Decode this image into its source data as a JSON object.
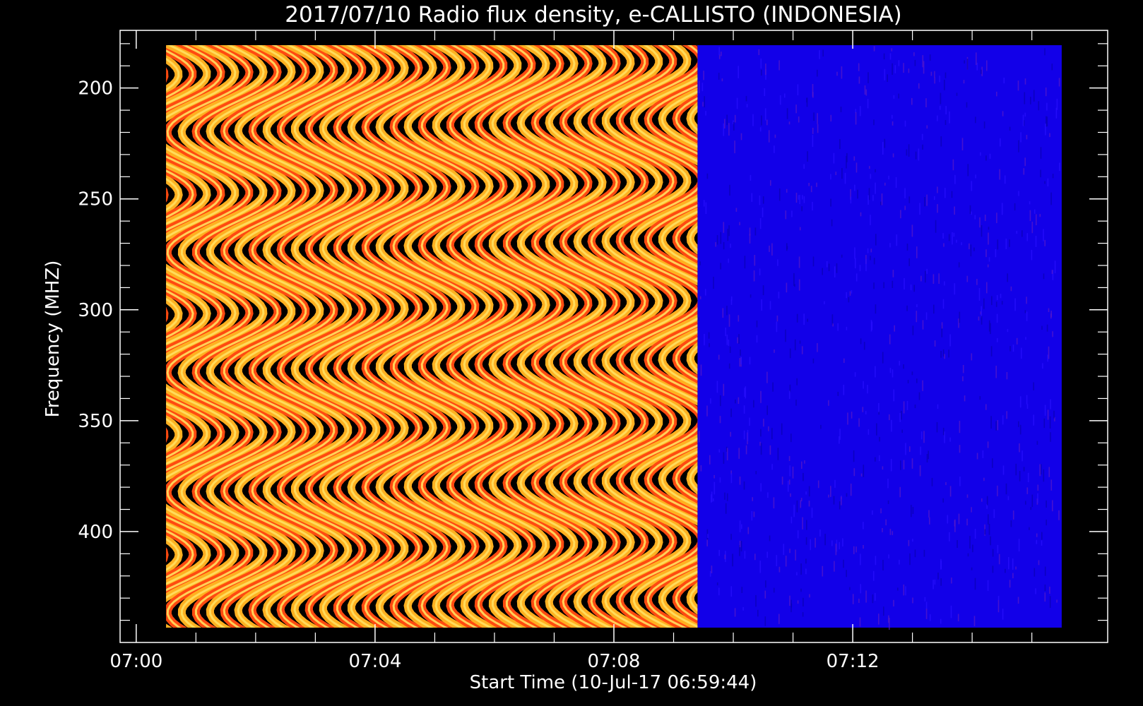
{
  "chart_data": {
    "type": "heatmap",
    "title": "2017/07/10  Radio flux density, e-CALLISTO (INDONESIA)",
    "xlabel": "Start Time (10-Jul-17 06:59:44)",
    "ylabel": "Frequency (MHZ)",
    "x_tick_labels": [
      "07:00",
      "07:04",
      "07:08",
      "07:12"
    ],
    "x_ticks_min": [
      0,
      4,
      8,
      12
    ],
    "xlim_min": [
      -0.27,
      16.27
    ],
    "data_xlim_min": [
      0.5,
      15.5
    ],
    "y_tick_labels": [
      "200",
      "250",
      "300",
      "350",
      "400"
    ],
    "y_ticks": [
      200,
      250,
      300,
      350,
      400
    ],
    "ylim": [
      174,
      450
    ],
    "y_inverted": true,
    "grid": false,
    "regions": [
      {
        "name": "interference",
        "start_min": 0.5,
        "end_min": 9.4,
        "colors": [
          "#000000",
          "#6a00c8",
          "#ff3a00",
          "#ffa000",
          "#ffe040"
        ]
      },
      {
        "name": "background",
        "start_min": 9.4,
        "end_min": 15.5,
        "colors": [
          "#1200e8",
          "#2a10ff",
          "#0a00b0",
          "#5a1ac8"
        ]
      }
    ]
  }
}
